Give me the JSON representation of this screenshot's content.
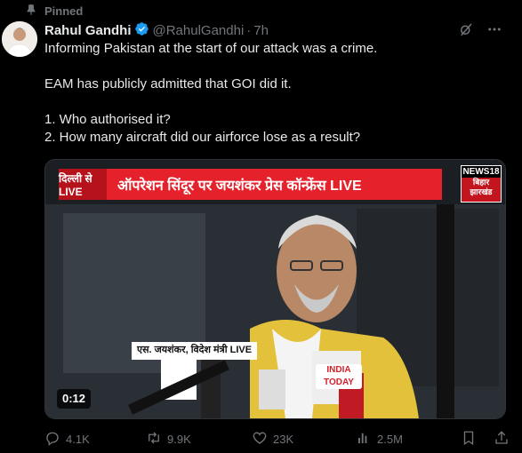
{
  "pinned_label": "Pinned",
  "author": {
    "name": "Rahul Gandhi",
    "handle": "@RahulGandhi",
    "dot": "·",
    "time": "7h"
  },
  "tweet_text": {
    "line1": "Informing Pakistan at the start of our attack was a crime.",
    "line2": "EAM has publicly admitted that GOI did it.",
    "line3": "1. Who authorised it?",
    "line4": "2. How many aircraft did our airforce lose as a result?"
  },
  "video": {
    "banner_left": "दिल्ली से LIVE",
    "banner_title": "ऑपरेशन सिंदूर पर जयशंकर प्रेस कॉन्फ्रेंस LIVE",
    "logo_line1": "NEWS18",
    "logo_line2": "बिहार",
    "logo_line3": "झारखंड",
    "lower_third": "एस. जयशंकर, विदेश मंत्री LIVE",
    "mic_text1": "INDIA",
    "mic_text2": "TODAY",
    "timer": "0:12"
  },
  "actions": {
    "replies": "4.1K",
    "retweets": "9.9K",
    "likes": "23K",
    "views": "2.5M"
  },
  "colors": {
    "background": "#000000",
    "text": "#e7e9ea",
    "muted": "#71767b",
    "verified": "#1d9bf0",
    "banner_red": "#e5212c"
  }
}
